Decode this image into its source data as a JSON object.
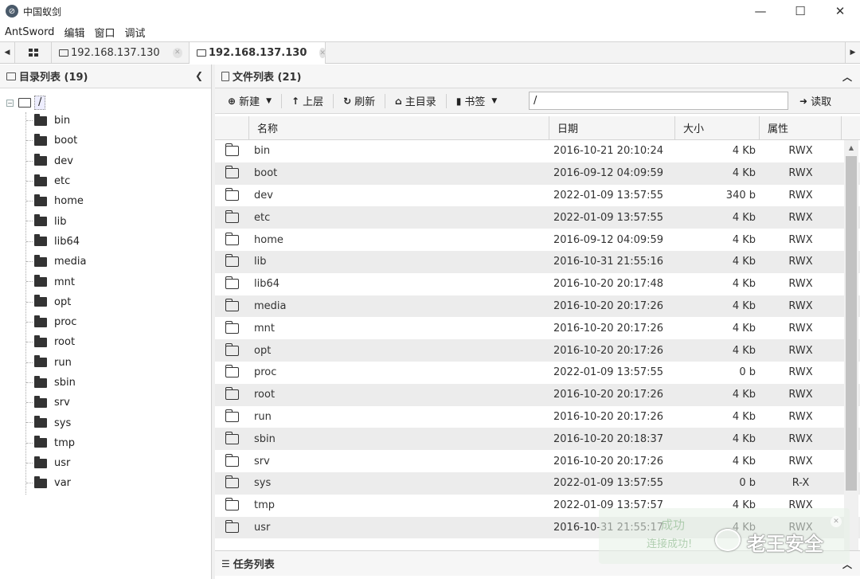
{
  "window": {
    "title": "中国蚁剑",
    "minimize": "—",
    "maximize": "☐",
    "close": "✕"
  },
  "menu": [
    "AntSword",
    "编辑",
    "窗口",
    "调试"
  ],
  "tabs": [
    {
      "label": "192.168.137.130",
      "active": false
    },
    {
      "label": "192.168.137.130",
      "active": true
    }
  ],
  "left_panel": {
    "title": "目录列表 (19)",
    "root": "/",
    "items": [
      "bin",
      "boot",
      "dev",
      "etc",
      "home",
      "lib",
      "lib64",
      "media",
      "mnt",
      "opt",
      "proc",
      "root",
      "run",
      "sbin",
      "srv",
      "sys",
      "tmp",
      "usr",
      "var"
    ]
  },
  "right_panel": {
    "title": "文件列表 (21)",
    "toolbar": {
      "new": "新建",
      "up": "上层",
      "refresh": "刷新",
      "home": "主目录",
      "bookmark": "书签",
      "path": "/",
      "read": "读取"
    },
    "columns": {
      "name": "名称",
      "date": "日期",
      "size": "大小",
      "attr": "属性"
    },
    "files": [
      {
        "name": "bin",
        "date": "2016-10-21 20:10:24",
        "size": "4 Kb",
        "attr": "RWX"
      },
      {
        "name": "boot",
        "date": "2016-09-12 04:09:59",
        "size": "4 Kb",
        "attr": "RWX"
      },
      {
        "name": "dev",
        "date": "2022-01-09 13:57:55",
        "size": "340 b",
        "attr": "RWX"
      },
      {
        "name": "etc",
        "date": "2022-01-09 13:57:55",
        "size": "4 Kb",
        "attr": "RWX"
      },
      {
        "name": "home",
        "date": "2016-09-12 04:09:59",
        "size": "4 Kb",
        "attr": "RWX"
      },
      {
        "name": "lib",
        "date": "2016-10-31 21:55:16",
        "size": "4 Kb",
        "attr": "RWX"
      },
      {
        "name": "lib64",
        "date": "2016-10-20 20:17:48",
        "size": "4 Kb",
        "attr": "RWX"
      },
      {
        "name": "media",
        "date": "2016-10-20 20:17:26",
        "size": "4 Kb",
        "attr": "RWX"
      },
      {
        "name": "mnt",
        "date": "2016-10-20 20:17:26",
        "size": "4 Kb",
        "attr": "RWX"
      },
      {
        "name": "opt",
        "date": "2016-10-20 20:17:26",
        "size": "4 Kb",
        "attr": "RWX"
      },
      {
        "name": "proc",
        "date": "2022-01-09 13:57:55",
        "size": "0 b",
        "attr": "RWX"
      },
      {
        "name": "root",
        "date": "2016-10-20 20:17:26",
        "size": "4 Kb",
        "attr": "RWX"
      },
      {
        "name": "run",
        "date": "2016-10-20 20:17:26",
        "size": "4 Kb",
        "attr": "RWX"
      },
      {
        "name": "sbin",
        "date": "2016-10-20 20:18:37",
        "size": "4 Kb",
        "attr": "RWX"
      },
      {
        "name": "srv",
        "date": "2016-10-20 20:17:26",
        "size": "4 Kb",
        "attr": "RWX"
      },
      {
        "name": "sys",
        "date": "2022-01-09 13:57:55",
        "size": "0 b",
        "attr": "R-X"
      },
      {
        "name": "tmp",
        "date": "2022-01-09 13:57:57",
        "size": "4 Kb",
        "attr": "RWX"
      },
      {
        "name": "usr",
        "date": "2016-10-31 21:55:17",
        "size": "4 Kb",
        "attr": "RWX"
      }
    ]
  },
  "task_panel": {
    "title": "任务列表"
  },
  "watermark": {
    "text": "老王安全",
    "toast1": "成功",
    "toast2": "连接成功!"
  }
}
